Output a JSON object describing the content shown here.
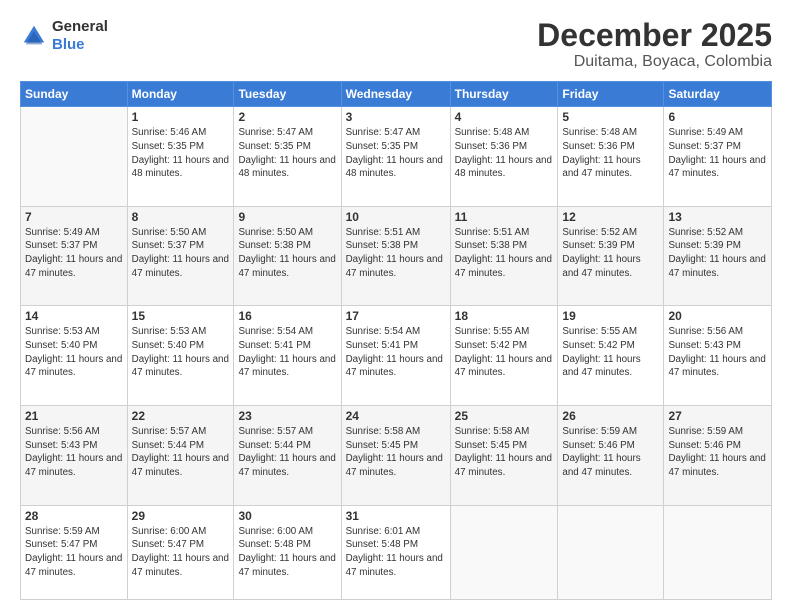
{
  "header": {
    "logo_general": "General",
    "logo_blue": "Blue",
    "month_title": "December 2025",
    "location": "Duitama, Boyaca, Colombia"
  },
  "weekdays": [
    "Sunday",
    "Monday",
    "Tuesday",
    "Wednesday",
    "Thursday",
    "Friday",
    "Saturday"
  ],
  "weeks": [
    [
      {
        "day": "",
        "sunrise": "",
        "sunset": "",
        "daylight": ""
      },
      {
        "day": "1",
        "sunrise": "Sunrise: 5:46 AM",
        "sunset": "Sunset: 5:35 PM",
        "daylight": "Daylight: 11 hours and 48 minutes."
      },
      {
        "day": "2",
        "sunrise": "Sunrise: 5:47 AM",
        "sunset": "Sunset: 5:35 PM",
        "daylight": "Daylight: 11 hours and 48 minutes."
      },
      {
        "day": "3",
        "sunrise": "Sunrise: 5:47 AM",
        "sunset": "Sunset: 5:35 PM",
        "daylight": "Daylight: 11 hours and 48 minutes."
      },
      {
        "day": "4",
        "sunrise": "Sunrise: 5:48 AM",
        "sunset": "Sunset: 5:36 PM",
        "daylight": "Daylight: 11 hours and 48 minutes."
      },
      {
        "day": "5",
        "sunrise": "Sunrise: 5:48 AM",
        "sunset": "Sunset: 5:36 PM",
        "daylight": "Daylight: 11 hours and 47 minutes."
      },
      {
        "day": "6",
        "sunrise": "Sunrise: 5:49 AM",
        "sunset": "Sunset: 5:37 PM",
        "daylight": "Daylight: 11 hours and 47 minutes."
      }
    ],
    [
      {
        "day": "7",
        "sunrise": "Sunrise: 5:49 AM",
        "sunset": "Sunset: 5:37 PM",
        "daylight": "Daylight: 11 hours and 47 minutes."
      },
      {
        "day": "8",
        "sunrise": "Sunrise: 5:50 AM",
        "sunset": "Sunset: 5:37 PM",
        "daylight": "Daylight: 11 hours and 47 minutes."
      },
      {
        "day": "9",
        "sunrise": "Sunrise: 5:50 AM",
        "sunset": "Sunset: 5:38 PM",
        "daylight": "Daylight: 11 hours and 47 minutes."
      },
      {
        "day": "10",
        "sunrise": "Sunrise: 5:51 AM",
        "sunset": "Sunset: 5:38 PM",
        "daylight": "Daylight: 11 hours and 47 minutes."
      },
      {
        "day": "11",
        "sunrise": "Sunrise: 5:51 AM",
        "sunset": "Sunset: 5:38 PM",
        "daylight": "Daylight: 11 hours and 47 minutes."
      },
      {
        "day": "12",
        "sunrise": "Sunrise: 5:52 AM",
        "sunset": "Sunset: 5:39 PM",
        "daylight": "Daylight: 11 hours and 47 minutes."
      },
      {
        "day": "13",
        "sunrise": "Sunrise: 5:52 AM",
        "sunset": "Sunset: 5:39 PM",
        "daylight": "Daylight: 11 hours and 47 minutes."
      }
    ],
    [
      {
        "day": "14",
        "sunrise": "Sunrise: 5:53 AM",
        "sunset": "Sunset: 5:40 PM",
        "daylight": "Daylight: 11 hours and 47 minutes."
      },
      {
        "day": "15",
        "sunrise": "Sunrise: 5:53 AM",
        "sunset": "Sunset: 5:40 PM",
        "daylight": "Daylight: 11 hours and 47 minutes."
      },
      {
        "day": "16",
        "sunrise": "Sunrise: 5:54 AM",
        "sunset": "Sunset: 5:41 PM",
        "daylight": "Daylight: 11 hours and 47 minutes."
      },
      {
        "day": "17",
        "sunrise": "Sunrise: 5:54 AM",
        "sunset": "Sunset: 5:41 PM",
        "daylight": "Daylight: 11 hours and 47 minutes."
      },
      {
        "day": "18",
        "sunrise": "Sunrise: 5:55 AM",
        "sunset": "Sunset: 5:42 PM",
        "daylight": "Daylight: 11 hours and 47 minutes."
      },
      {
        "day": "19",
        "sunrise": "Sunrise: 5:55 AM",
        "sunset": "Sunset: 5:42 PM",
        "daylight": "Daylight: 11 hours and 47 minutes."
      },
      {
        "day": "20",
        "sunrise": "Sunrise: 5:56 AM",
        "sunset": "Sunset: 5:43 PM",
        "daylight": "Daylight: 11 hours and 47 minutes."
      }
    ],
    [
      {
        "day": "21",
        "sunrise": "Sunrise: 5:56 AM",
        "sunset": "Sunset: 5:43 PM",
        "daylight": "Daylight: 11 hours and 47 minutes."
      },
      {
        "day": "22",
        "sunrise": "Sunrise: 5:57 AM",
        "sunset": "Sunset: 5:44 PM",
        "daylight": "Daylight: 11 hours and 47 minutes."
      },
      {
        "day": "23",
        "sunrise": "Sunrise: 5:57 AM",
        "sunset": "Sunset: 5:44 PM",
        "daylight": "Daylight: 11 hours and 47 minutes."
      },
      {
        "day": "24",
        "sunrise": "Sunrise: 5:58 AM",
        "sunset": "Sunset: 5:45 PM",
        "daylight": "Daylight: 11 hours and 47 minutes."
      },
      {
        "day": "25",
        "sunrise": "Sunrise: 5:58 AM",
        "sunset": "Sunset: 5:45 PM",
        "daylight": "Daylight: 11 hours and 47 minutes."
      },
      {
        "day": "26",
        "sunrise": "Sunrise: 5:59 AM",
        "sunset": "Sunset: 5:46 PM",
        "daylight": "Daylight: 11 hours and 47 minutes."
      },
      {
        "day": "27",
        "sunrise": "Sunrise: 5:59 AM",
        "sunset": "Sunset: 5:46 PM",
        "daylight": "Daylight: 11 hours and 47 minutes."
      }
    ],
    [
      {
        "day": "28",
        "sunrise": "Sunrise: 5:59 AM",
        "sunset": "Sunset: 5:47 PM",
        "daylight": "Daylight: 11 hours and 47 minutes."
      },
      {
        "day": "29",
        "sunrise": "Sunrise: 6:00 AM",
        "sunset": "Sunset: 5:47 PM",
        "daylight": "Daylight: 11 hours and 47 minutes."
      },
      {
        "day": "30",
        "sunrise": "Sunrise: 6:00 AM",
        "sunset": "Sunset: 5:48 PM",
        "daylight": "Daylight: 11 hours and 47 minutes."
      },
      {
        "day": "31",
        "sunrise": "Sunrise: 6:01 AM",
        "sunset": "Sunset: 5:48 PM",
        "daylight": "Daylight: 11 hours and 47 minutes."
      },
      {
        "day": "",
        "sunrise": "",
        "sunset": "",
        "daylight": ""
      },
      {
        "day": "",
        "sunrise": "",
        "sunset": "",
        "daylight": ""
      },
      {
        "day": "",
        "sunrise": "",
        "sunset": "",
        "daylight": ""
      }
    ]
  ]
}
